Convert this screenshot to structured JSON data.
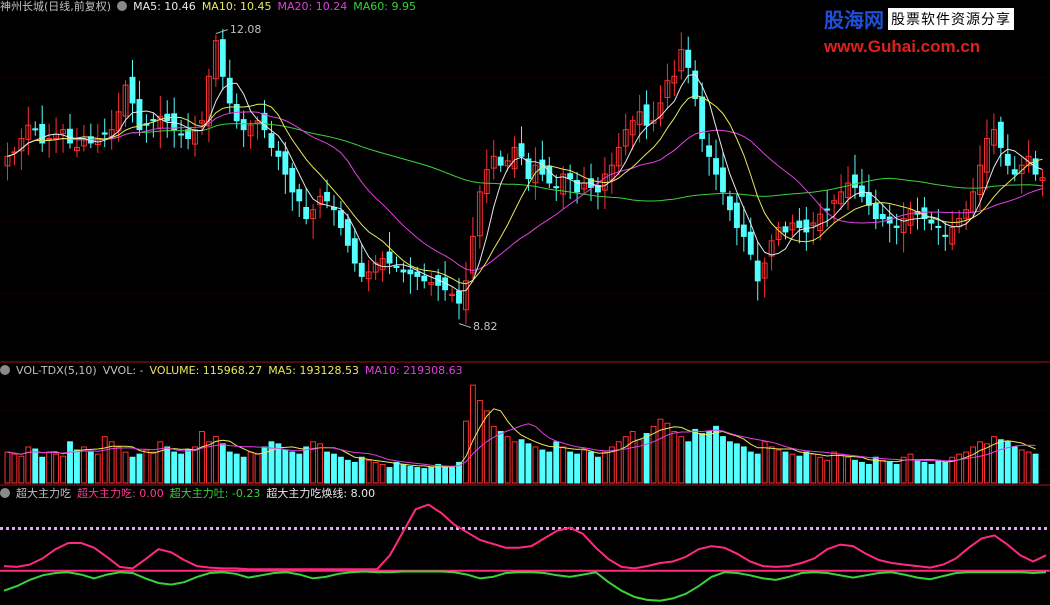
{
  "panels": {
    "price": {
      "stock": "神州长城(日线,前复权)",
      "indicators": [
        {
          "label": "MA5: 10.46",
          "color": "#e8e8e8"
        },
        {
          "label": "MA10: 10.45",
          "color": "#e8e85a"
        },
        {
          "label": "MA20: 10.24",
          "color": "#e040e0"
        },
        {
          "label": "MA60: 9.95",
          "color": "#3ad23a"
        }
      ],
      "high_label": "12.08",
      "low_label": "8.82"
    },
    "volume": {
      "name": "VOL-TDX(5,10)",
      "vvol": "VVOL: -",
      "indicators": [
        {
          "label": "VOLUME: 115968.27",
          "color": "#e8e85a"
        },
        {
          "label": "MA5: 193128.53",
          "color": "#e8e85a"
        },
        {
          "label": "MA10: 219308.63",
          "color": "#e040e0"
        }
      ]
    },
    "flow": {
      "name": "超大主力吃",
      "indicators": [
        {
          "label": "超大主力吃: 0.00",
          "color": "#ff3a8c"
        },
        {
          "label": "超大主力吐: -0.23",
          "color": "#3ad23a"
        },
        {
          "label": "超大主力吃焕线: 8.00",
          "color": "#e8e8e8"
        }
      ]
    }
  },
  "watermark": {
    "brand": "股海网",
    "slogan": "股票软件资源分享",
    "url": "www.Guhai.com.cn"
  },
  "colors": {
    "up": "#ff3030",
    "down": "#54ffff",
    "ma5": "#e8e8e8",
    "ma10": "#e8e85a",
    "ma20": "#e040e0",
    "ma60": "#3ad23a",
    "eat": "#ff2a80",
    "spit": "#3ad23a",
    "divider": "#a01010"
  },
  "chart_data": {
    "type": "candlestick",
    "series": [
      {
        "name": "MA5",
        "values": [
          10.46
        ]
      },
      {
        "name": "MA10",
        "values": [
          10.45
        ]
      },
      {
        "name": "MA20",
        "values": [
          10.24
        ]
      },
      {
        "name": "MA60",
        "values": [
          9.95
        ]
      }
    ],
    "annotations": [
      {
        "text": "12.08",
        "value": 12.08
      },
      {
        "text": "8.82",
        "value": 8.82
      }
    ],
    "ylim": [
      8.5,
      12.3
    ],
    "closes": [
      10.7,
      10.75,
      10.9,
      11.05,
      11.0,
      10.85,
      10.9,
      10.95,
      11.0,
      10.85,
      10.8,
      10.9,
      10.85,
      10.9,
      10.95,
      11.0,
      11.2,
      11.5,
      11.3,
      11.0,
      11.05,
      11.1,
      11.15,
      11.1,
      11.0,
      10.95,
      10.9,
      11.0,
      11.1,
      11.6,
      12.0,
      11.6,
      11.3,
      11.1,
      11.0,
      11.05,
      11.1,
      11.0,
      10.8,
      10.7,
      10.5,
      10.3,
      10.2,
      10.0,
      10.1,
      10.25,
      10.2,
      10.1,
      9.9,
      9.7,
      9.5,
      9.35,
      9.4,
      9.5,
      9.55,
      9.5,
      9.45,
      9.4,
      9.38,
      9.35,
      9.3,
      9.28,
      9.25,
      9.2,
      9.15,
      9.05,
      9.3,
      9.8,
      10.3,
      10.55,
      10.7,
      10.6,
      10.65,
      10.8,
      10.7,
      10.45,
      10.6,
      10.5,
      10.4,
      10.35,
      10.5,
      10.45,
      10.3,
      10.4,
      10.35,
      10.3,
      10.5,
      10.6,
      10.8,
      11.0,
      11.1,
      11.2,
      11.05,
      11.1,
      11.3,
      11.55,
      11.6,
      11.9,
      11.7,
      11.35,
      10.9,
      10.7,
      10.5,
      10.3,
      10.1,
      9.9,
      9.8,
      9.6,
      9.3,
      9.5,
      9.75,
      9.9,
      9.85,
      9.95,
      9.9,
      9.85,
      9.95,
      10.05,
      10.1,
      10.2,
      10.3,
      10.4,
      10.35,
      10.25,
      10.15,
      10.0,
      10.0,
      9.95,
      9.9,
      10.0,
      10.1,
      10.05,
      10.0,
      9.95,
      9.9,
      9.8,
      9.9,
      10.0,
      10.1,
      10.3,
      10.6,
      10.9,
      11.0,
      10.8,
      10.6,
      10.5,
      10.6,
      10.7,
      10.5,
      10.46
    ],
    "volume": [
      30,
      28,
      26,
      35,
      33,
      25,
      30,
      28,
      26,
      40,
      32,
      35,
      30,
      28,
      45,
      40,
      35,
      30,
      25,
      28,
      32,
      30,
      40,
      35,
      30,
      28,
      32,
      35,
      50,
      40,
      45,
      38,
      30,
      28,
      25,
      30,
      28,
      35,
      40,
      38,
      32,
      30,
      28,
      35,
      40,
      38,
      30,
      28,
      25,
      22,
      20,
      25,
      22,
      20,
      18,
      15,
      20,
      18,
      16,
      15,
      14,
      15,
      18,
      16,
      15,
      20,
      60,
      95,
      80,
      70,
      55,
      50,
      45,
      40,
      42,
      38,
      35,
      32,
      30,
      40,
      35,
      30,
      28,
      32,
      30,
      25,
      30,
      35,
      40,
      45,
      50,
      42,
      48,
      55,
      62,
      58,
      50,
      45,
      40,
      52,
      48,
      50,
      55,
      45,
      40,
      38,
      35,
      30,
      28,
      40,
      35,
      32,
      30,
      28,
      26,
      30,
      28,
      25,
      22,
      30,
      28,
      25,
      22,
      20,
      18,
      25,
      22,
      20,
      18,
      25,
      28,
      22,
      20,
      18,
      22,
      20,
      25,
      28,
      30,
      35,
      40,
      38,
      45,
      42,
      40,
      35,
      32,
      30,
      28
    ],
    "flow_eat": [
      0.6,
      0.5,
      0.8,
      1.6,
      2.8,
      3.6,
      3.6,
      3.0,
      1.8,
      0.5,
      0.3,
      1.5,
      2.8,
      2.4,
      1.4,
      0.6,
      0.4,
      0.3,
      0.3,
      0.2,
      0.2,
      0.2,
      0.2,
      0.2,
      0.2,
      0.2,
      0.2,
      0.2,
      0.2,
      0.2,
      2.0,
      5.0,
      8.0,
      8.6,
      7.5,
      6.0,
      5.0,
      4.0,
      3.5,
      3.0,
      3.0,
      3.2,
      4.2,
      5.2,
      5.6,
      4.8,
      3.0,
      1.5,
      0.5,
      0.3,
      0.6,
      1.0,
      1.2,
      1.8,
      2.8,
      3.2,
      3.0,
      2.2,
      1.2,
      0.6,
      0.5,
      0.6,
      1.0,
      1.6,
      2.8,
      3.4,
      3.2,
      2.2,
      1.4,
      1.0,
      0.8,
      0.6,
      0.4,
      0.8,
      1.6,
      3.0,
      4.2,
      4.6,
      3.4,
      2.0,
      1.2,
      2.0
    ],
    "flow_spit": [
      -2.6,
      -2.0,
      -1.2,
      -0.6,
      -0.3,
      -0.2,
      -0.5,
      -1.0,
      -0.5,
      -0.2,
      -0.3,
      -1.0,
      -1.6,
      -1.8,
      -1.5,
      -0.8,
      -0.3,
      -0.2,
      -0.4,
      -0.9,
      -0.6,
      -0.3,
      -0.2,
      -0.5,
      -1.0,
      -0.8,
      -0.4,
      -0.2,
      -0.1,
      -0.2,
      -0.2,
      -0.1,
      -0.1,
      -0.1,
      -0.1,
      -0.2,
      -0.5,
      -1.0,
      -0.8,
      -0.3,
      -0.2,
      -0.2,
      -0.3,
      -0.6,
      -0.8,
      -0.5,
      -0.2,
      -1.5,
      -2.6,
      -3.4,
      -3.8,
      -3.9,
      -3.6,
      -3.0,
      -2.0,
      -0.8,
      -0.2,
      -0.3,
      -0.6,
      -1.0,
      -1.2,
      -0.8,
      -0.3,
      -0.2,
      -0.3,
      -0.6,
      -0.9,
      -0.6,
      -0.3,
      -0.2,
      -0.5,
      -0.9,
      -1.1,
      -0.7,
      -0.3,
      -0.2,
      -0.2,
      -0.2,
      -0.2,
      -0.2,
      -0.3,
      -0.2
    ]
  }
}
